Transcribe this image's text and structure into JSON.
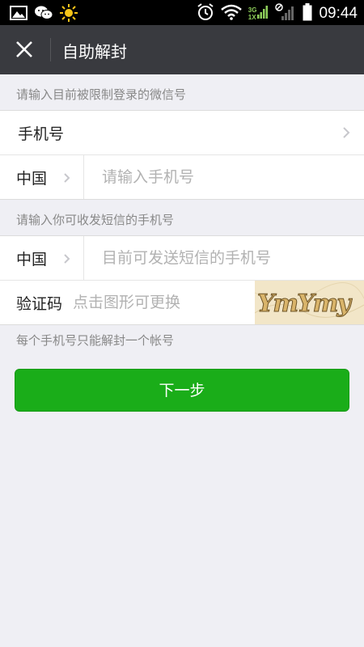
{
  "status_bar": {
    "network_top": "3G",
    "network_bottom": "1X",
    "time": "09:44"
  },
  "header": {
    "title": "自助解封"
  },
  "section1": {
    "label": "请输入目前被限制登录的微信号",
    "account_type": "手机号",
    "country": "中国",
    "phone_placeholder": "请输入手机号"
  },
  "section2": {
    "label": "请输入你可收发短信的手机号",
    "country": "中国",
    "phone_placeholder": "目前可发送短信的手机号",
    "captcha_label": "验证码",
    "captcha_placeholder": "点击图形可更换",
    "captcha_text": "YmYmy"
  },
  "note": "每个手机号只能解封一个帐号",
  "next_button": "下一步"
}
